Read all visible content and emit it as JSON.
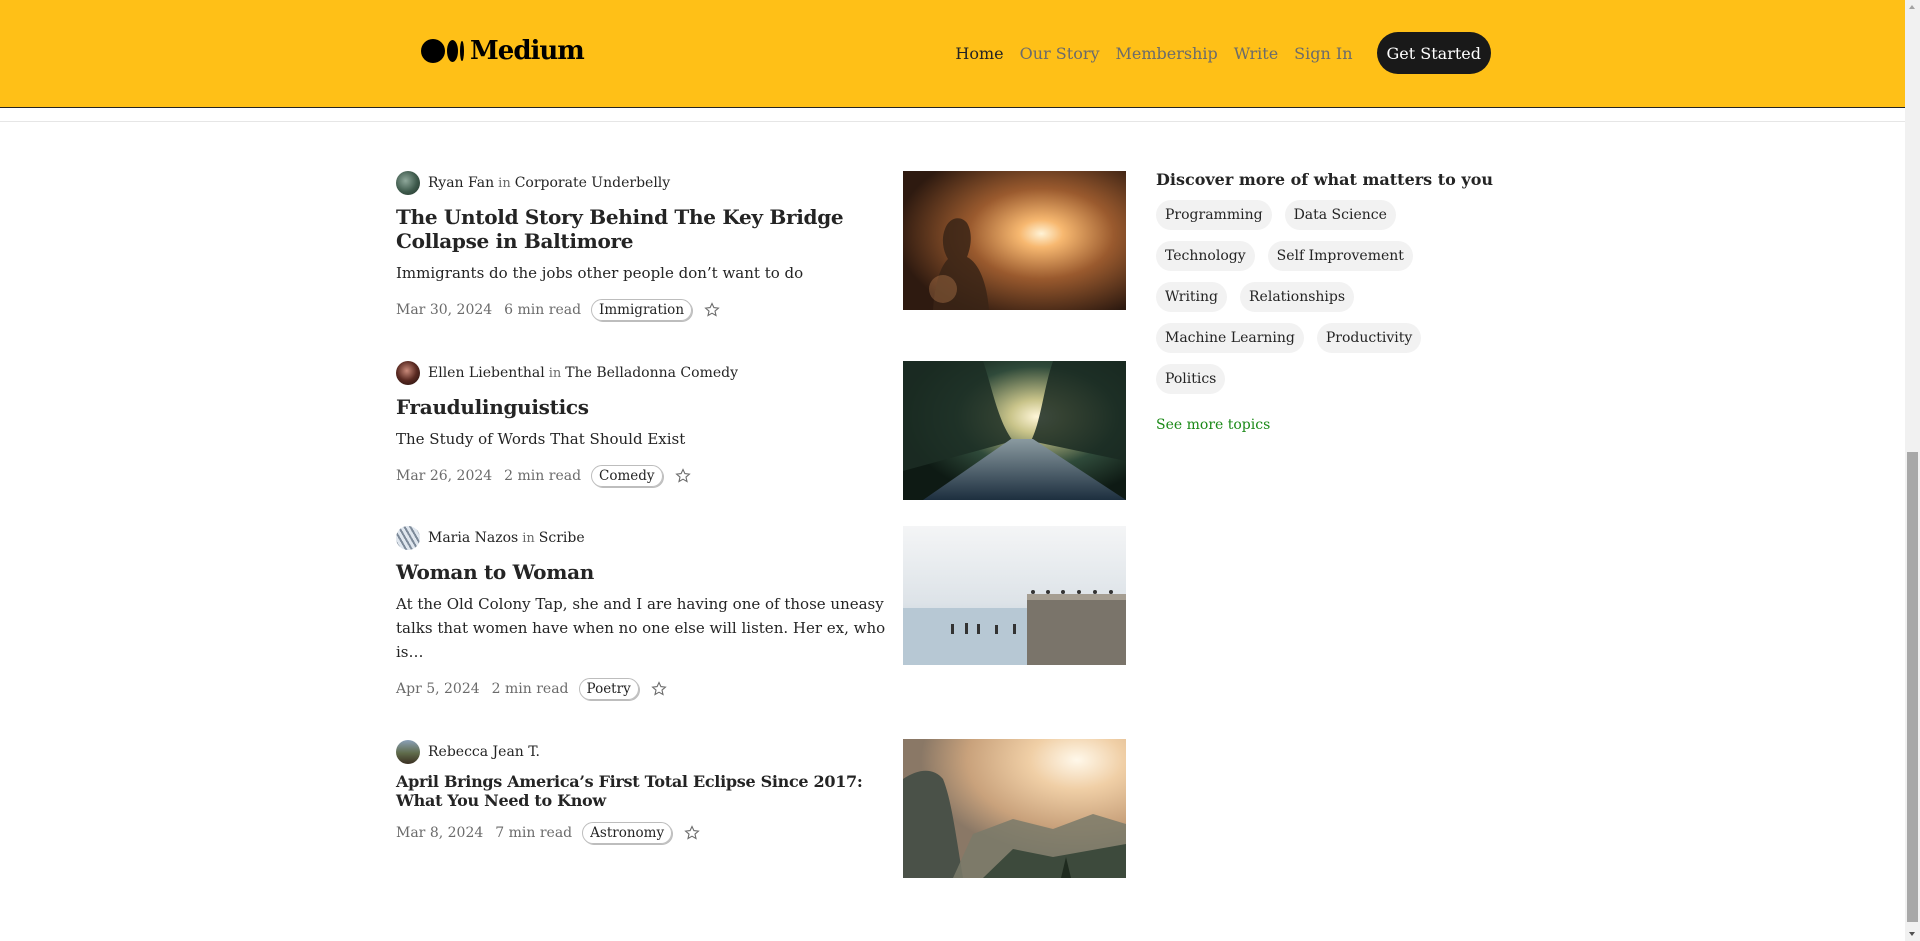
{
  "header": {
    "logo_text": "Medium",
    "nav": [
      {
        "label": "Home",
        "active": true
      },
      {
        "label": "Our Story",
        "active": false
      },
      {
        "label": "Membership",
        "active": false
      },
      {
        "label": "Write",
        "active": false
      },
      {
        "label": "Sign In",
        "active": false
      }
    ],
    "cta_label": "Get Started",
    "bg_color": "#ffc017"
  },
  "articles": [
    {
      "author": "Ryan Fan",
      "in_word": "in",
      "publication": "Corporate Underbelly",
      "title": "The Untold Story Behind The Key Bridge Collapse in Baltimore",
      "subtitle": "Immigrants do the jobs other people don’t want to do",
      "date": "Mar 30, 2024",
      "read_time": "6 min read",
      "tag": "Immigration",
      "thumbnail": "person-sunset-photo"
    },
    {
      "author": "Ellen Liebenthal",
      "in_word": "in",
      "publication": "The Belladonna Comedy",
      "title": "Fraudulinguistics",
      "subtitle": "The Study of Words That Should Exist",
      "date": "Mar 26, 2024",
      "read_time": "2 min read",
      "tag": "Comedy",
      "thumbnail": "tree-road-photo"
    },
    {
      "author": "Maria Nazos",
      "in_word": "in",
      "publication": "Scribe",
      "title": "Woman to Woman",
      "subtitle": "At the Old Colony Tap, she and I are having one of those uneasy talks that women have when no one else will listen. Her ex, who is…",
      "date": "Apr 5, 2024",
      "read_time": "2 min read",
      "tag": "Poetry",
      "thumbnail": "seawall-birds-photo"
    },
    {
      "author": "Rebecca Jean T.",
      "in_word": "",
      "publication": "",
      "title": "April Brings America’s First Total Eclipse Since 2017: What You Need to Know",
      "subtitle": "",
      "date": "Mar 8, 2024",
      "read_time": "7 min read",
      "tag": "Astronomy",
      "thumbnail": "mountain-valley-photo"
    }
  ],
  "sidebar": {
    "title": "Discover more of what matters to you",
    "topics": [
      "Programming",
      "Data Science",
      "Technology",
      "Self Improvement",
      "Writing",
      "Relationships",
      "Machine Learning",
      "Productivity",
      "Politics"
    ],
    "see_more": "See more topics",
    "link_color": "#1a8917"
  }
}
